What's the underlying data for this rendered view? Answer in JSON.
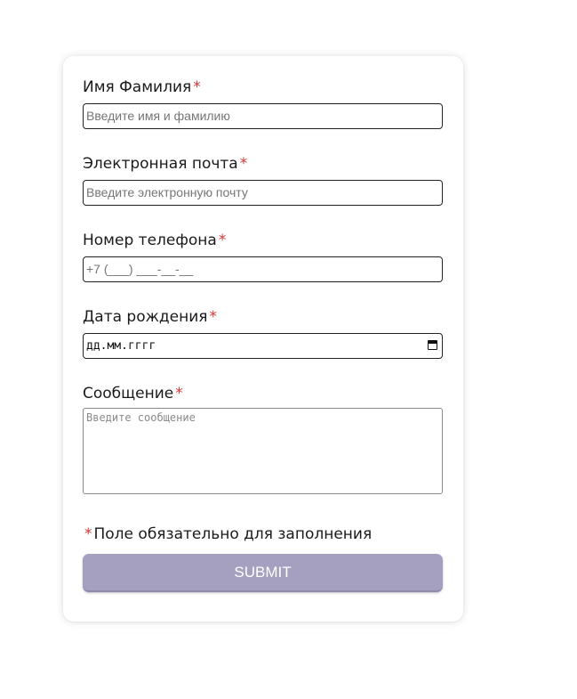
{
  "form": {
    "required_mark": "*",
    "fields": [
      {
        "label": "Имя Фамилия",
        "placeholder": "Введите имя и фамилию"
      },
      {
        "label": "Электронная почта",
        "placeholder": "Введите электронную почту"
      },
      {
        "label": "Номер телефона",
        "placeholder": "+7 (___) ___-__-__"
      },
      {
        "label": "Дата рождения",
        "placeholder": "дд.мм.гггг"
      },
      {
        "label": "Сообщение",
        "placeholder": "Введите сообщение"
      }
    ],
    "required_note": "Поле обязательно для заполнения",
    "submit_label": "SUBMIT",
    "colors": {
      "required": "#d93636",
      "submit_bg": "#a6a0c0",
      "submit_text": "#ffffff"
    }
  }
}
